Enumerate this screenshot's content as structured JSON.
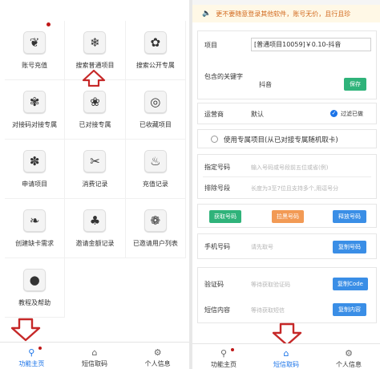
{
  "left": {
    "grid": [
      {
        "label": "账号充值",
        "icon": "leaf-icon",
        "glyph": "❦",
        "dot": true
      },
      {
        "label": "搜索普通项目",
        "icon": "snowflake-icon",
        "glyph": "❄",
        "dot": false
      },
      {
        "label": "搜索公开专属",
        "icon": "flower-icon",
        "glyph": "✿",
        "dot": false
      },
      {
        "label": "对接码对接专属",
        "icon": "gear-flower-icon",
        "glyph": "✾",
        "dot": false
      },
      {
        "label": "已对接专属",
        "icon": "blossom-icon",
        "glyph": "❀",
        "dot": false
      },
      {
        "label": "已收藏项目",
        "icon": "spiral-icon",
        "glyph": "◎",
        "dot": false
      },
      {
        "label": "申请项目",
        "icon": "petal-flower-icon",
        "glyph": "✽",
        "dot": false
      },
      {
        "label": "消费记录",
        "icon": "tools-icon",
        "glyph": "✂",
        "dot": false
      },
      {
        "label": "充值记录",
        "icon": "snail-icon",
        "glyph": "♨",
        "dot": false
      },
      {
        "label": "创建缺卡需求",
        "icon": "grass-icon",
        "glyph": "❧",
        "dot": false
      },
      {
        "label": "邀请金额记录",
        "icon": "plants-icon",
        "glyph": "♣",
        "dot": false
      },
      {
        "label": "已邀请用户列表",
        "icon": "tulip-icon",
        "glyph": "❁",
        "dot": false
      },
      {
        "label": "教程及帮助",
        "icon": "drop-icon",
        "glyph": "●",
        "dot": false
      }
    ],
    "tabs": [
      {
        "label": "功能主页",
        "icon": "search-icon",
        "glyph": "⚲",
        "active": true,
        "dot": true
      },
      {
        "label": "短信取码",
        "icon": "home-icon",
        "glyph": "⌂",
        "active": false,
        "dot": false
      },
      {
        "label": "个人信息",
        "icon": "settings-icon",
        "glyph": "⚙",
        "active": false,
        "dot": false
      }
    ]
  },
  "right": {
    "notice": "更不要随意登录其他软件，账号无价，且行且珍",
    "project_label": "项目",
    "project_value": "[普通项目10059]￥0.10-抖音",
    "keyword_label": "包含的关键字",
    "keyword_value": "抖音",
    "save_label": "保存",
    "operator_label": "运营商",
    "operator_value": "默认",
    "filter_label": "过滤已做",
    "exclusive_label": "使用专属项目(从已对接专属随机取卡)",
    "assign_label": "指定号码",
    "assign_placeholder": "输入号码或号段前五位或省(例)",
    "exclude_label": "排除号段",
    "exclude_placeholder": "长度为3至7位且支持多个,用逗号分",
    "get_number": "获取号码",
    "blacklist": "拉黑号码",
    "release": "释放号码",
    "phone_label": "手机号码",
    "phone_placeholder": "请先取号",
    "copy_number": "复制号码",
    "code_label": "验证码",
    "code_placeholder": "等待获取验证码",
    "copy_code": "复制Code",
    "sms_label": "短信内容",
    "sms_placeholder": "等待获取短信",
    "copy_content": "复制内容",
    "tabs": [
      {
        "label": "功能主页",
        "icon": "search-icon",
        "glyph": "⚲",
        "active": false,
        "dot": true
      },
      {
        "label": "短信取码",
        "icon": "home-icon",
        "glyph": "⌂",
        "active": true,
        "dot": false
      },
      {
        "label": "个人信息",
        "icon": "settings-icon",
        "glyph": "⚙",
        "active": false,
        "dot": false
      }
    ]
  },
  "colors": {
    "accent": "#1a73e8",
    "arrow": "#c62828",
    "green": "#2fb37a",
    "blue": "#3a8ee6",
    "orange": "#f29a55"
  }
}
